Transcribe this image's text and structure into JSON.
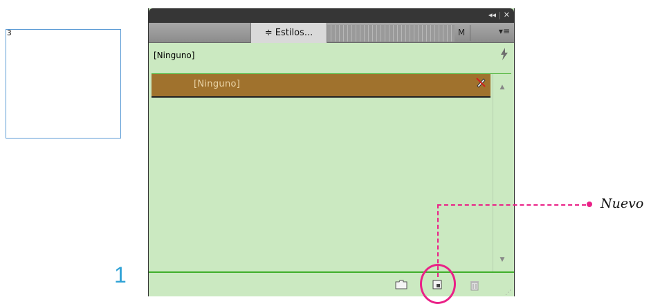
{
  "frame": {
    "label": "3"
  },
  "step_number": "1",
  "panel": {
    "titlebar": {
      "collapse": "◂◂",
      "close": "✕"
    },
    "tabs": [
      {
        "label": "≑ Estilos..."
      },
      {
        "label": "M"
      }
    ],
    "menu": "▾≡",
    "style_header": "[Ninguno]",
    "list": {
      "items": [
        {
          "label": "[Ninguno]"
        }
      ]
    }
  },
  "callout": {
    "text": "Nuevo"
  },
  "colors": {
    "panel_bg": "#cbe9c1",
    "selected_row": "#a0722d",
    "accent_green": "#3fae2a",
    "callout": "#ea2187",
    "step_number": "#2fa2d6"
  }
}
